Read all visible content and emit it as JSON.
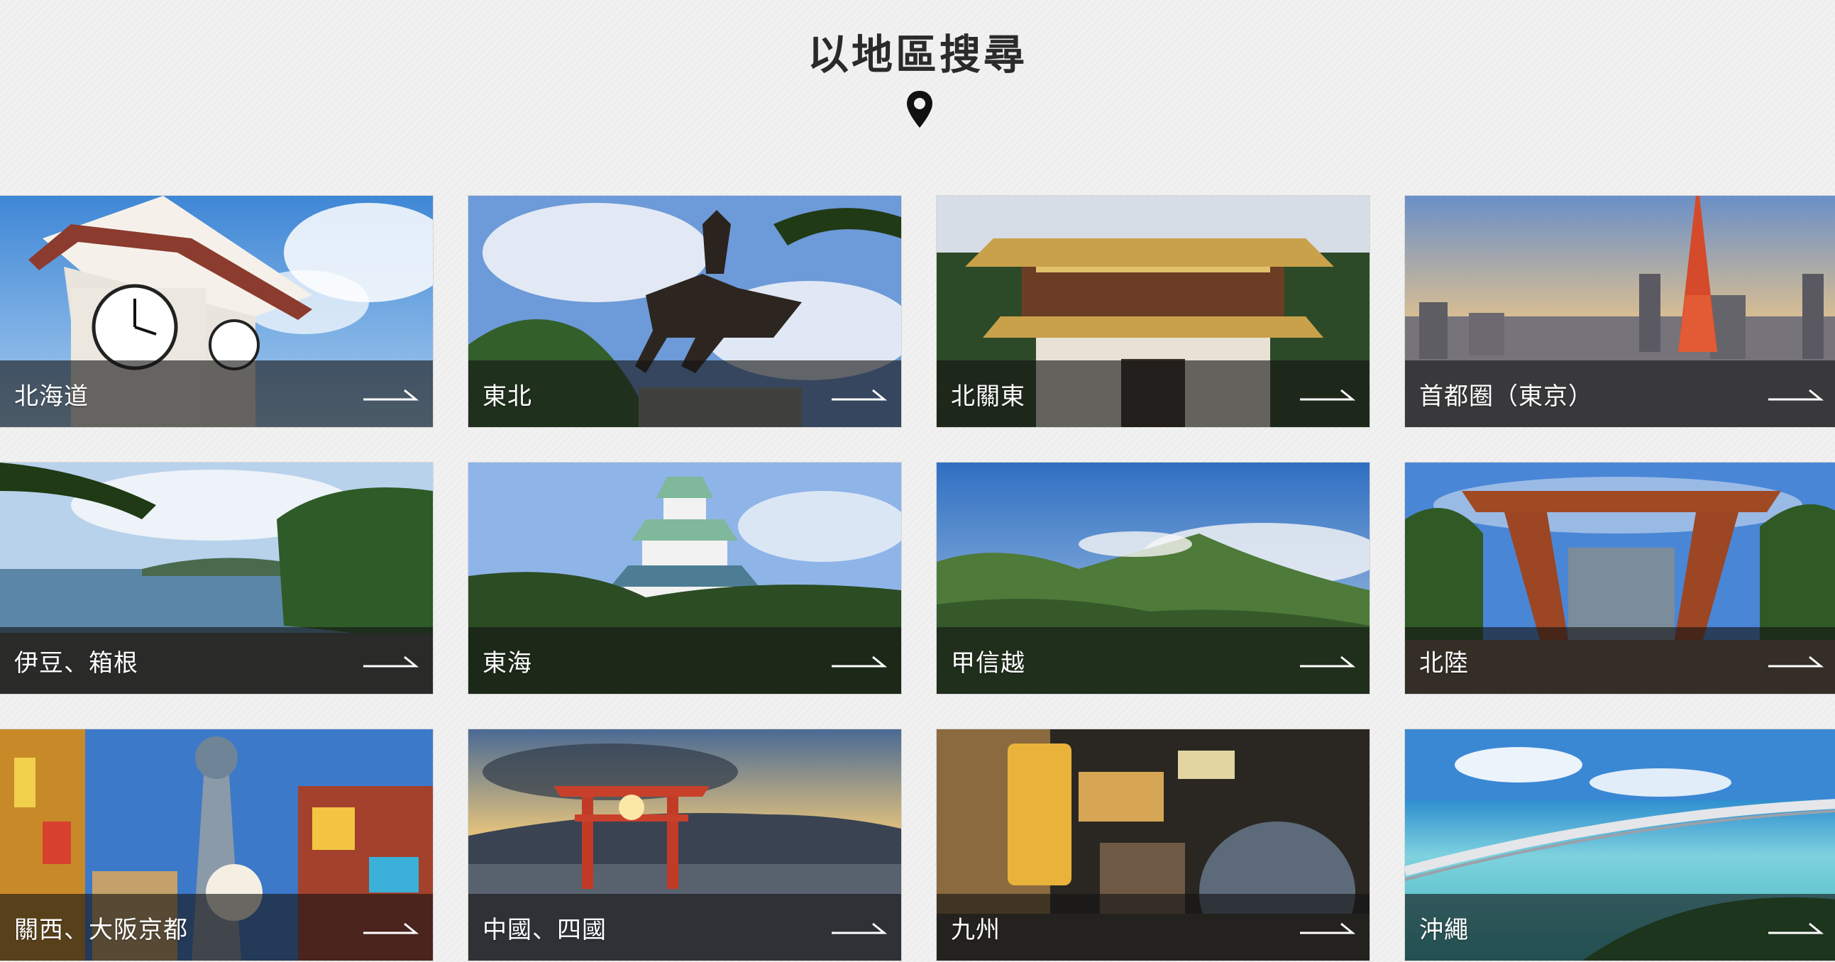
{
  "header": {
    "title": "以地區搜尋",
    "icon": "map-pin-icon"
  },
  "regions": [
    {
      "label": "北海道",
      "scene": "clock-tower"
    },
    {
      "label": "東北",
      "scene": "samurai-statue"
    },
    {
      "label": "北關東",
      "scene": "shrine-gate"
    },
    {
      "label": "首都圈（東京）",
      "scene": "tokyo-skyline"
    },
    {
      "label": "伊豆、箱根",
      "scene": "coast"
    },
    {
      "label": "東海",
      "scene": "castle"
    },
    {
      "label": "甲信越",
      "scene": "mountains"
    },
    {
      "label": "北陸",
      "scene": "torii-gate-station"
    },
    {
      "label": "關西、大阪京都",
      "scene": "neon-street"
    },
    {
      "label": "中國、四國",
      "scene": "floating-torii"
    },
    {
      "label": "九州",
      "scene": "food-stalls"
    },
    {
      "label": "沖繩",
      "scene": "sea-bridge"
    }
  ],
  "icons": {
    "arrow": "arrow-right-icon"
  },
  "colors": {
    "background": "#f1f1f1",
    "title": "#2a2a2a",
    "label": "#ffffff",
    "bar": "#141414"
  }
}
